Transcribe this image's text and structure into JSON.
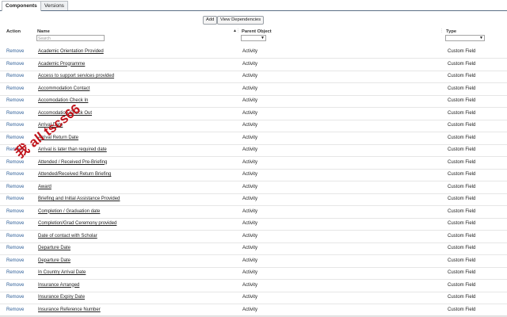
{
  "tabs": [
    {
      "label": "Components",
      "active": true
    },
    {
      "label": "Versions",
      "active": false
    }
  ],
  "buttons": {
    "add": "Add",
    "view_dependencies": "View Dependencies"
  },
  "columns": {
    "action": "Action",
    "name": "Name",
    "parent": "Parent Object",
    "type": "Type"
  },
  "search_placeholder": "Search",
  "watermark": "我 all tscs66",
  "rows": [
    {
      "action": "Remove",
      "name": "Academic Orientation Provided",
      "parent": "Activity",
      "type": "Custom Field"
    },
    {
      "action": "Remove",
      "name": "Academic Programme",
      "parent": "Activity",
      "type": "Custom Field"
    },
    {
      "action": "Remove",
      "name": "Access to support services provided",
      "parent": "Activity",
      "type": "Custom Field"
    },
    {
      "action": "Remove",
      "name": "Accommodation Contact",
      "parent": "Activity",
      "type": "Custom Field"
    },
    {
      "action": "Remove",
      "name": "Accomodation Check In",
      "parent": "Activity",
      "type": "Custom Field"
    },
    {
      "action": "Remove",
      "name": "Accomodation Check Out",
      "parent": "Activity",
      "type": "Custom Field"
    },
    {
      "action": "Remove",
      "name": "Arrival Date",
      "parent": "Activity",
      "type": "Custom Field"
    },
    {
      "action": "Remove",
      "name": "Arrival Return Date",
      "parent": "Activity",
      "type": "Custom Field"
    },
    {
      "action": "Remove",
      "name": "Arrival is later than required date",
      "parent": "Activity",
      "type": "Custom Field"
    },
    {
      "action": "Remove",
      "name": "Attended / Received Pre-Briefing",
      "parent": "Activity",
      "type": "Custom Field"
    },
    {
      "action": "Remove",
      "name": "Attended/Received Return Briefing",
      "parent": "Activity",
      "type": "Custom Field"
    },
    {
      "action": "Remove",
      "name": "Award",
      "parent": "Activity",
      "type": "Custom Field"
    },
    {
      "action": "Remove",
      "name": "Briefing and Initial Assistance Provided",
      "parent": "Activity",
      "type": "Custom Field"
    },
    {
      "action": "Remove",
      "name": "Completion / Graduation date",
      "parent": "Activity",
      "type": "Custom Field"
    },
    {
      "action": "Remove",
      "name": "Completion/Grad Ceremony provided",
      "parent": "Activity",
      "type": "Custom Field"
    },
    {
      "action": "Remove",
      "name": "Date of contact with Scholar",
      "parent": "Activity",
      "type": "Custom Field"
    },
    {
      "action": "Remove",
      "name": "Departure Date",
      "parent": "Activity",
      "type": "Custom Field"
    },
    {
      "action": "Remove",
      "name": "Departure Date",
      "parent": "Activity",
      "type": "Custom Field"
    },
    {
      "action": "Remove",
      "name": "In Country Arrival Date",
      "parent": "Activity",
      "type": "Custom Field"
    },
    {
      "action": "Remove",
      "name": "Insurance Arranged",
      "parent": "Activity",
      "type": "Custom Field"
    },
    {
      "action": "Remove",
      "name": "Insurance Expiry Date",
      "parent": "Activity",
      "type": "Custom Field"
    },
    {
      "action": "Remove",
      "name": "Insurance Reference Number",
      "parent": "Activity",
      "type": "Custom Field"
    }
  ]
}
